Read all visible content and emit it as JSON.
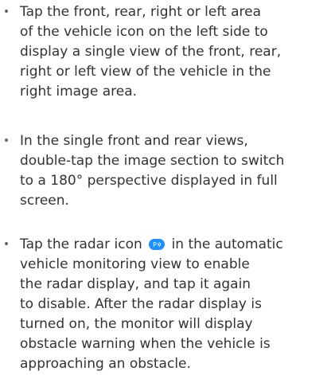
{
  "colors": {
    "text": "#333333",
    "bullet": "#666666",
    "radar_icon_bg": "#1e90ff",
    "radar_icon_fg": "#ffffff"
  },
  "items": [
    {
      "lines": [
        "Tap the front, rear, right or left area",
        "of the vehicle icon on the left side to",
        "display a single view of the front, rear,",
        "right or left view of the vehicle in the",
        "right image area."
      ]
    },
    {
      "lines": [
        "In the single front and rear views,",
        "double-tap the image section to switch",
        "to a 180° perspective displayed in full",
        "screen."
      ]
    },
    {
      "line1_before": "Tap the radar icon",
      "line1_after": "in the automatic",
      "radar_icon": "radar-icon",
      "lines": [
        "vehicle monitoring view to enable",
        "the radar display, and tap it again",
        "to disable. After the radar display is",
        "turned on, the monitor will display",
        "obstacle warning when the vehicle is",
        "approaching an obstacle."
      ]
    }
  ]
}
